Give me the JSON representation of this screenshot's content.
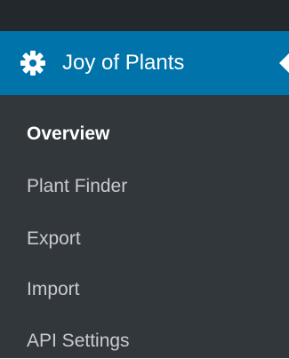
{
  "menu": {
    "title": "Joy of Plants",
    "icon": "gear-icon",
    "accent_color": "#0073aa",
    "sidebar_color": "#32373c"
  },
  "submenu": {
    "items": [
      {
        "label": "Overview",
        "current": true
      },
      {
        "label": "Plant Finder",
        "current": false
      },
      {
        "label": "Export",
        "current": false
      },
      {
        "label": "Import",
        "current": false
      },
      {
        "label": "API Settings",
        "current": false
      }
    ]
  }
}
